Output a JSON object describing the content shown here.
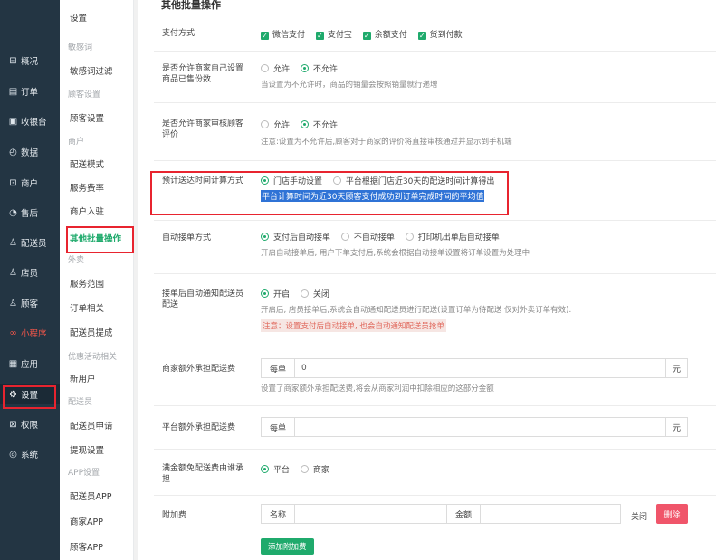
{
  "nav": {
    "items": [
      {
        "icon": "overview-icon",
        "glyph": "⊟",
        "label": "概况"
      },
      {
        "icon": "order-icon",
        "glyph": "▤",
        "label": "订单"
      },
      {
        "icon": "cashier-icon",
        "glyph": "▣",
        "label": "收银台"
      },
      {
        "icon": "data-icon",
        "glyph": "◴",
        "label": "数据"
      },
      {
        "icon": "store-icon",
        "glyph": "⊡",
        "label": "商户"
      },
      {
        "icon": "after-sale-icon",
        "glyph": "◔",
        "label": "售后"
      },
      {
        "icon": "delivery-person-icon",
        "glyph": "♙",
        "label": "配送员"
      },
      {
        "icon": "clerk-icon",
        "glyph": "♙",
        "label": "店员"
      },
      {
        "icon": "customer-icon",
        "glyph": "♙",
        "label": "顾客"
      },
      {
        "icon": "mini-program-icon",
        "glyph": "∞",
        "label": "小程序"
      },
      {
        "icon": "apps-icon",
        "glyph": "▦",
        "label": "应用"
      },
      {
        "icon": "settings-icon",
        "glyph": "⚙",
        "label": "设置"
      },
      {
        "icon": "permission-icon",
        "glyph": "⊠",
        "label": "权限"
      },
      {
        "icon": "system-icon",
        "glyph": "◎",
        "label": "系统"
      }
    ]
  },
  "submenu": {
    "head": "设置",
    "groups": [
      {
        "title": "敏感词",
        "items": [
          "敏感词过滤"
        ]
      },
      {
        "title": "顾客设置",
        "items": [
          "顾客设置"
        ]
      },
      {
        "title": "商户",
        "items": [
          "配送模式",
          "服务费率",
          "商户入驻",
          "其他批量操作"
        ]
      },
      {
        "title": "外卖",
        "items": [
          "服务范围",
          "订单相关",
          "配送员提成"
        ]
      },
      {
        "title": "优惠活动相关",
        "items": [
          "新用户"
        ]
      },
      {
        "title": "配送员",
        "items": [
          "配送员申请",
          "提现设置"
        ]
      },
      {
        "title": "APP设置",
        "items": [
          "配送员APP",
          "商家APP",
          "顾客APP"
        ]
      }
    ]
  },
  "main": {
    "section_title": "其他批量操作",
    "payment": {
      "label": "支付方式",
      "options": [
        "微信支付",
        "支付宝",
        "余额支付",
        "货到付款"
      ]
    },
    "sold_count": {
      "label": "是否允许商家自己设置商品已售份数",
      "options": [
        "允许",
        "不允许"
      ],
      "hint": "当设置为不允许时，商品的销量会按照销量就行递增"
    },
    "review": {
      "label": "是否允许商家审核顾客评价",
      "options": [
        "允许",
        "不允许"
      ],
      "hint": "注意:设置为不允许后,顾客对于商家的评价将直接审核通过并显示到手机端"
    },
    "delivery_time": {
      "label": "预计送达时间计算方式",
      "options": [
        "门店手动设置",
        "平台根据门店近30天的配送时间计算得出"
      ],
      "highlight": "平台计算时间为近30天顾客支付成功到订单完成时间的平均值"
    },
    "auto_accept": {
      "label": "自动接单方式",
      "options": [
        "支付后自动接单",
        "不自动接单",
        "打印机出单后自动接单"
      ],
      "hint": "开启自动接单后, 用户下单支付后,系统会根据自动接单设置将订单设置为处理中"
    },
    "auto_notify": {
      "label": "接单后自动通知配送员配送",
      "options": [
        "开启",
        "关闭"
      ],
      "hint": "开启后, 店员接单后,系统会自动通知配送员进行配送(设置订单为待配送 仅对外卖订单有效).",
      "note": "注意：设置支付后自动接单, 也会自动通知配送员抢单"
    },
    "merchant_fee": {
      "label": "商家额外承担配送费",
      "prefix": "每单",
      "value": "0",
      "suffix": "元",
      "hint": "设置了商家额外承担配送费,将会从商家利润中扣除相应的这部分金额"
    },
    "platform_fee": {
      "label": "平台额外承担配送费",
      "prefix": "每单",
      "value": "",
      "suffix": "元"
    },
    "free_delivery": {
      "label": "满金额免配送费由谁承担",
      "options": [
        "平台",
        "商家"
      ]
    },
    "surcharge": {
      "label": "附加费",
      "name_label": "名称",
      "amount_label": "金额",
      "close_label": "关闭",
      "delete_label": "删除",
      "add_label": "添加附加费"
    }
  }
}
